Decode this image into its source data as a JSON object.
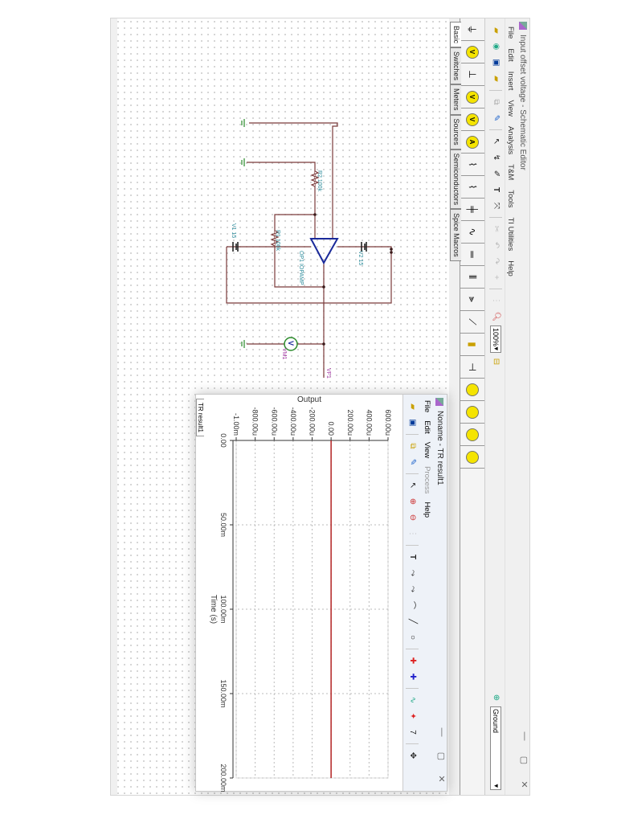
{
  "main_window": {
    "title": "Input offset voltage - Schematic Editor",
    "controls": {
      "minimize": "—",
      "maximize": "▢",
      "close": "✕"
    },
    "menu": [
      "File",
      "Edit",
      "Insert",
      "View",
      "Analysis",
      "T&M",
      "Tools",
      "TI Utilities",
      "Help"
    ],
    "zoom_value": "100%",
    "component_select": "Ground",
    "component_tabs": [
      "Basic",
      "Switches",
      "Meters",
      "Sources",
      "Semiconductors",
      "Spice Macros"
    ],
    "active_tab": "Basic"
  },
  "schematic": {
    "labels": {
      "r2": "R2 100k",
      "r1": "R1 100k",
      "v1": "V1 15",
      "op1": "OP1 IOPAMP",
      "v2": "V2 15",
      "vm1": "VM1",
      "vf1": "VF1",
      "voltmeter_glyph": "V"
    }
  },
  "result_window": {
    "title": "Noname - TR result1",
    "controls": {
      "minimize": "—",
      "maximize": "▢",
      "close": "✕"
    },
    "menu": [
      "File",
      "Edit",
      "View",
      "Process",
      "Help"
    ],
    "tab": "TR result1"
  },
  "chart_data": {
    "type": "line",
    "ylabel": "Output",
    "xlabel": "Time (s)",
    "xlim": [
      0,
      200
    ],
    "ylim": [
      -1000,
      600
    ],
    "x_ticks": [
      {
        "v": 0,
        "label": "0.00"
      },
      {
        "v": 50,
        "label": "50.00m"
      },
      {
        "v": 100,
        "label": "100.00m"
      },
      {
        "v": 150,
        "label": "150.00m"
      },
      {
        "v": 200,
        "label": "200.00m"
      }
    ],
    "y_ticks": [
      {
        "v": 600,
        "label": "600.00u"
      },
      {
        "v": 400,
        "label": "400.00u"
      },
      {
        "v": 200,
        "label": "200.00u"
      },
      {
        "v": 0,
        "label": "0.00"
      },
      {
        "v": -200,
        "label": "-200.00u"
      },
      {
        "v": -400,
        "label": "-400.00u"
      },
      {
        "v": -600,
        "label": "-600.00u"
      },
      {
        "v": -800,
        "label": "-800.00u"
      },
      {
        "v": -1000,
        "label": "-1.00m"
      }
    ],
    "grid": true,
    "series": [
      {
        "name": "Output",
        "color": "#b22222",
        "x": [
          0,
          200
        ],
        "y": [
          0,
          0
        ]
      }
    ]
  }
}
